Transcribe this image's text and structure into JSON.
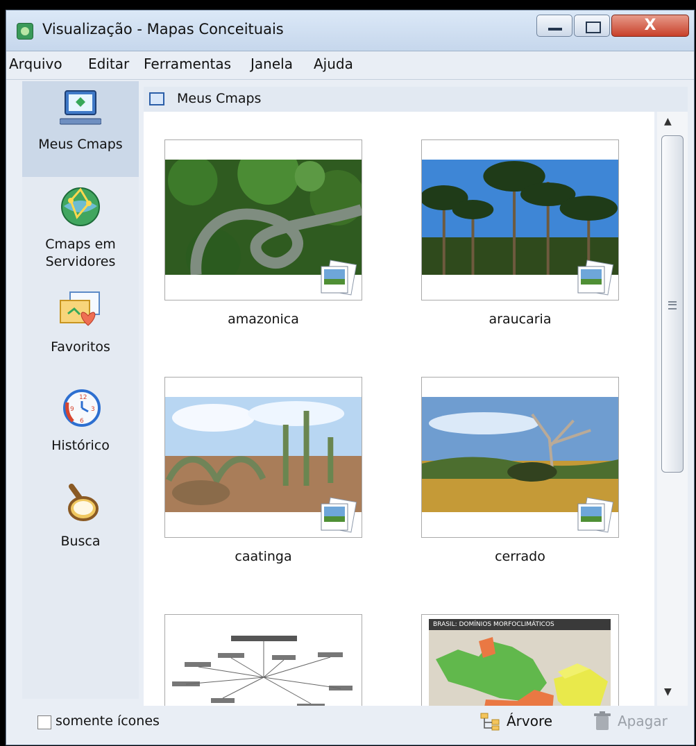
{
  "window": {
    "title": "Visualização - Mapas Conceituais"
  },
  "titlebar": {
    "close_glyph": "X"
  },
  "menu": [
    "Arquivo",
    "Editar",
    "Ferramentas",
    "Janela",
    "Ajuda"
  ],
  "sidebar": {
    "items": [
      {
        "label": "Meus Cmaps",
        "icon": "monitor-icon"
      },
      {
        "label": "Cmaps em Servidores",
        "icon": "globe-network-icon"
      },
      {
        "label": "Favoritos",
        "icon": "favorites-folder-icon"
      },
      {
        "label": "Histórico",
        "icon": "clock-history-icon"
      },
      {
        "label": "Busca",
        "icon": "magnifier-icon"
      }
    ]
  },
  "header": {
    "title": "Meus Cmaps"
  },
  "items": [
    {
      "label": "amazonica"
    },
    {
      "label": "araucaria"
    },
    {
      "label": "caatinga"
    },
    {
      "label": "cerrado"
    },
    {
      "label": ""
    },
    {
      "label": "",
      "map_title": "BRASIL: DOMÍNIOS MORFOCLIMÁTICOS"
    }
  ],
  "bottom": {
    "checkbox_label": "somente ícones",
    "tree_label": "Árvore",
    "delete_label": "Apagar"
  }
}
